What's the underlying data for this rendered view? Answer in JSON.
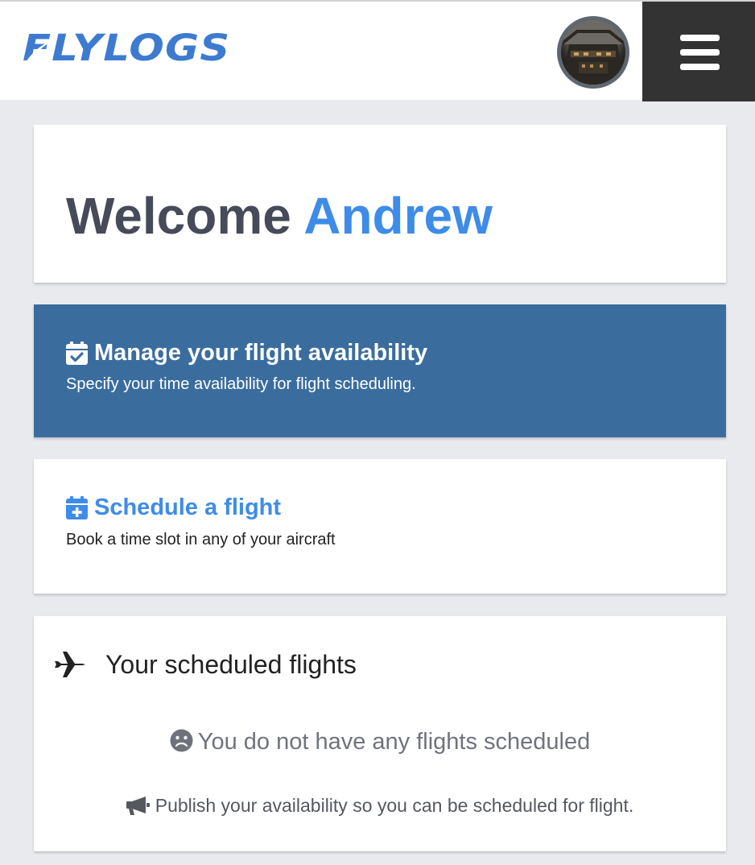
{
  "header": {
    "logo_text": "FLYLOGS",
    "avatar_alt": "cockpit-photo",
    "menu_icon": "hamburger-menu-icon"
  },
  "welcome": {
    "greeting": "Welcome",
    "name": "Andrew"
  },
  "availability_card": {
    "icon": "calendar-check-icon",
    "title": "Manage your flight availability",
    "subtitle": "Specify your time availability for flight scheduling."
  },
  "schedule_card": {
    "icon": "calendar-plus-icon",
    "title": "Schedule a flight",
    "subtitle": "Book a time slot in any of your aircraft"
  },
  "flights_card": {
    "icon": "plane-icon",
    "title": "Your scheduled flights",
    "empty_icon": "sad-face-icon",
    "empty_message": "You do not have any flights scheduled",
    "publish_icon": "megaphone-icon",
    "publish_message": "Publish your availability so you can be scheduled for flight."
  },
  "colors": {
    "brand_blue": "#3e8ce8",
    "availability_bg": "#3a6d9e",
    "menu_bg": "#333333",
    "page_bg": "#e9eaed"
  }
}
